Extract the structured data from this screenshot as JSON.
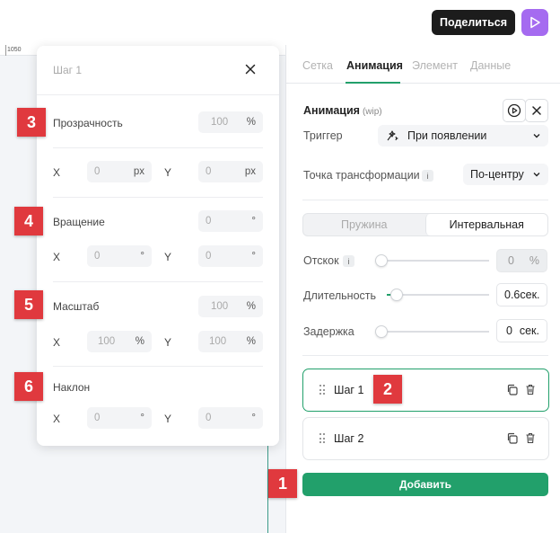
{
  "header": {
    "share_label": "Поделиться"
  },
  "ruler": {
    "tick": "1050"
  },
  "tabs": [
    "Сетка",
    "Анимация",
    "Элемент",
    "Данные"
  ],
  "animation": {
    "title": "Анимация",
    "title_note": "(wip)",
    "trigger_label": "Триггер",
    "trigger_value": "При появлении",
    "origin_label": "Точка трансформации",
    "origin_value": "По-центру",
    "modes": [
      "Пружина",
      "Интервальная"
    ],
    "selected_mode": "Интервальная",
    "bounce_label": "Отскок",
    "bounce_value": "0",
    "bounce_unit": "%",
    "duration_label": "Длительность",
    "duration_value": "0.6",
    "duration_unit": "сек.",
    "delay_label": "Задержка",
    "delay_value": "0",
    "delay_unit": "сек.",
    "steps": [
      "Шаг 1",
      "Шаг 2"
    ],
    "add_label": "Добавить"
  },
  "step_panel": {
    "title": "Шаг 1",
    "opacity_label": "Прозрачность",
    "opacity_value": "100",
    "opacity_unit": "%",
    "x_label": "X",
    "y_label": "Y",
    "translate_x": "0",
    "translate_y": "0",
    "translate_unit": "px",
    "rotate_label": "Вращение",
    "rotate_value": "0",
    "rotate_x": "0",
    "rotate_y": "0",
    "deg_unit": "°",
    "scale_label": "Масштаб",
    "scale_value": "100",
    "scale_x": "100",
    "scale_y": "100",
    "percent_unit": "%",
    "skew_label": "Наклон",
    "skew_x": "0",
    "skew_y": "0"
  },
  "badges": [
    "1",
    "2",
    "3",
    "4",
    "5",
    "6"
  ],
  "colors": {
    "accent": "#22a06b",
    "badge": "#e0393e",
    "play": "#a56bf0"
  }
}
